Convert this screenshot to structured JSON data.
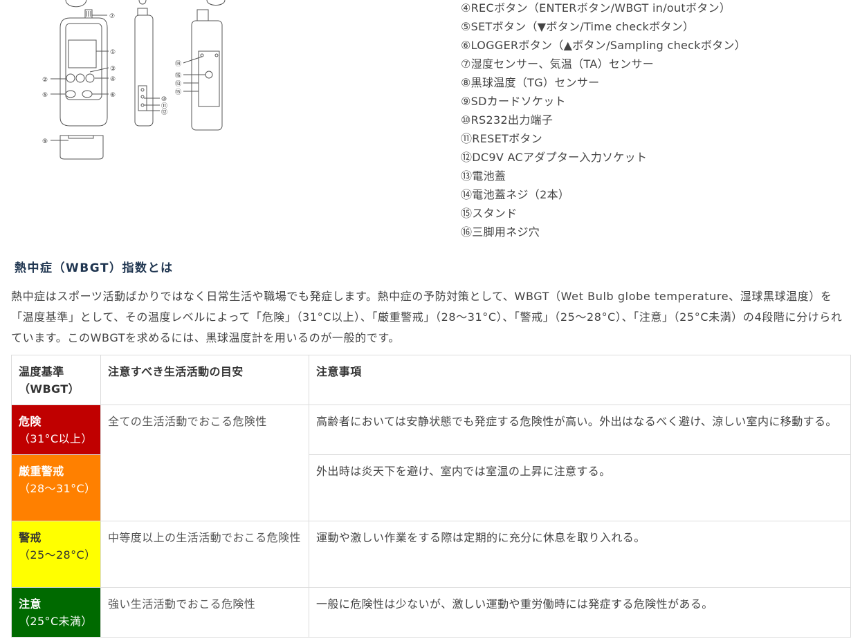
{
  "parts": [
    "④RECボタン（ENTERボタン/WBGT in/outボタン）",
    "⑤SETボタン（▼ボタン/Time checkボタン）",
    "⑥LOGGERボタン（▲ボタン/Sampling checkボタン）",
    "⑦湿度センサー、気温（TA）センサー",
    "⑧黒球温度（TG）センサー",
    "⑨SDカードソケット",
    "⑩RS232出力端子",
    "⑪RESETボタン",
    "⑫DC9V ACアダプター入力ソケット",
    "⑬電池蓋",
    "⑭電池蓋ネジ（2本）",
    "⑮スタンド",
    "⑯三脚用ネジ穴"
  ],
  "diagram_labels": [
    "⑦",
    "①",
    "②",
    "③",
    "④",
    "⑤",
    "⑥",
    "⑨",
    "⑩",
    "⑪",
    "⑫",
    "⑭",
    "⑯",
    "⑬",
    "⑮"
  ],
  "heading": "熱中症（WBGT）指数とは",
  "intro": "熱中症はスポーツ活動ばかりではなく日常生活や職場でも発症します。熱中症の予防対策として、WBGT（Wet Bulb globe temperature、湿球黒球温度）を「温度基準」として、その温度レベルによって「危険」（31°C以上）、「厳重警戒」（28～31°C）、「警戒」（25～28°C）、「注意」（25°C未満）の4段階に分けられています。このWBGTを求めるには、黒球温度計を用いるのが一般的です。",
  "table": {
    "headers": [
      "温度基準（WBGT）",
      "注意すべき生活活動の目安",
      "注意事項"
    ],
    "rows": [
      {
        "level": "危険",
        "range": "（31°C以上）",
        "activity": "全ての生活活動でおこる危険性",
        "note": "高齢者においては安静状態でも発症する危険性が高い。外出はなるべく避け、涼しい室内に移動する。"
      },
      {
        "level": "厳重警戒",
        "range": "（28～31°C）",
        "activity": "",
        "note": "外出時は炎天下を避け、室内では室温の上昇に注意する。"
      },
      {
        "level": "警戒",
        "range": "（25～28°C）",
        "activity": "中等度以上の生活活動でおこる危険性",
        "note": "運動や激しい作業をする際は定期的に充分に休息を取り入れる。"
      },
      {
        "level": "注意",
        "range": "（25°C未満）",
        "activity": "強い生活活動でおこる危険性",
        "note": "一般に危険性は少ないが、激しい運動や重労働時には発症する危険性がある。"
      }
    ]
  },
  "colors": {
    "danger": "#c00000",
    "severe": "#ff8000",
    "warning": "#ffff00",
    "caution": "#006a00",
    "heading": "#1f3550"
  }
}
